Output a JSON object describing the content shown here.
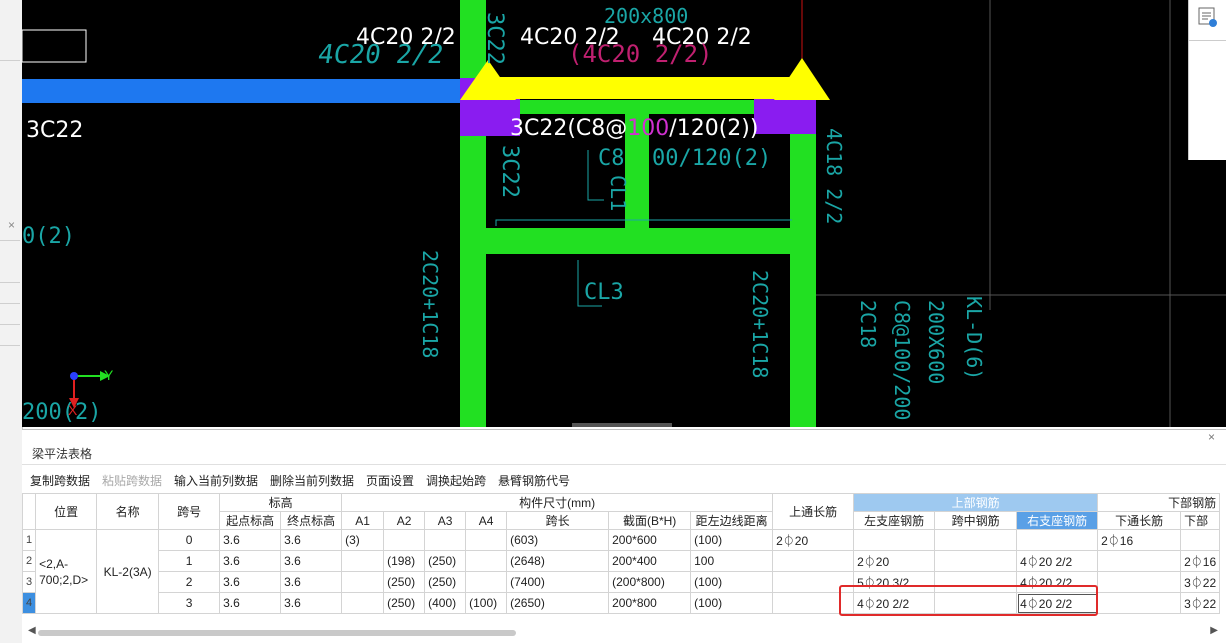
{
  "colors": {
    "cad_bg": "#000000",
    "beam_green": "#22e022",
    "beam_blue": "#1e78f0",
    "support_purple": "#8a1cf0",
    "arrow_yellow": "#ffff00",
    "cad_cyan": "#1aa6a6",
    "header_highlight": "#9ec9f0",
    "highlight_red": "#e02a2a"
  },
  "cad": {
    "labels_white": [
      "4C20 2/2",
      "4C20 2/2",
      "4C20 2/2",
      "3C22",
      "3C22(C8@",
      "100",
      "/120(2))"
    ],
    "labels_cyan": [
      "4C20 2/2",
      "3C22",
      "200x800",
      "3C22",
      "C8",
      "00/120(2)",
      "CL1",
      "CL3",
      "4C18 2/2",
      "2C20+1C18",
      "2C20+1C18",
      "KL-D(6)",
      "200X600",
      "C8@100/200",
      "2C18",
      "0(2)",
      "200(2)"
    ],
    "label_pink": "(4C20 2/2)",
    "axis_y": "Y",
    "axis_x": "X"
  },
  "panel": {
    "title": "梁平法表格",
    "close": "×",
    "toolbar": [
      {
        "label": "复制跨数据",
        "enabled": true
      },
      {
        "label": "粘贴跨数据",
        "enabled": false
      },
      {
        "label": "输入当前列数据",
        "enabled": true
      },
      {
        "label": "删除当前列数据",
        "enabled": true
      },
      {
        "label": "页面设置",
        "enabled": true
      },
      {
        "label": "调换起始跨",
        "enabled": true
      },
      {
        "label": "悬臂钢筋代号",
        "enabled": true
      }
    ],
    "headers": {
      "position": "位置",
      "name": "名称",
      "span_no": "跨号",
      "elevation": "标高",
      "start_elev": "起点标高",
      "end_elev": "终点标高",
      "dims": "构件尺寸(mm)",
      "a1": "A1",
      "a2": "A2",
      "a3": "A3",
      "a4": "A4",
      "span_len": "跨长",
      "section": "截面(B*H)",
      "edge_dist": "距左边线距离",
      "top_through": "上通长筋",
      "top_rebar": "上部钢筋",
      "left_support": "左支座钢筋",
      "mid_span": "跨中钢筋",
      "right_support": "右支座钢筋",
      "bottom_rebar": "下部钢筋",
      "bottom_through": "下通长筋",
      "bottom_cut": "下部"
    },
    "row_numbers": [
      "1",
      "2",
      "3",
      "4"
    ],
    "position_value": "<2,A-700;2,D>",
    "name_value": "KL-2(3A)",
    "rows": [
      {
        "span": "0",
        "start": "3.6",
        "end": "3.6",
        "a1": "(3)",
        "a2": "",
        "a3": "",
        "a4": "",
        "len": "(603)",
        "section": "200*600",
        "dist": "(100)",
        "top_through": "2⏀20",
        "left": "",
        "mid": "",
        "right": "",
        "bot_through": "2⏀16",
        "bot": ""
      },
      {
        "span": "1",
        "start": "3.6",
        "end": "3.6",
        "a1": "",
        "a2": "(198)",
        "a3": "(250)",
        "a4": "",
        "len": "(2648)",
        "section": "200*400",
        "dist": "100",
        "top_through": "",
        "left": "2⏀20",
        "mid": "",
        "right": "4⏀20 2/2",
        "bot_through": "",
        "bot": "2⏀16"
      },
      {
        "span": "2",
        "start": "3.6",
        "end": "3.6",
        "a1": "",
        "a2": "(250)",
        "a3": "(250)",
        "a4": "",
        "len": "(7400)",
        "section": "(200*800)",
        "dist": "(100)",
        "top_through": "",
        "left": "5⏀20 3/2",
        "mid": "",
        "right": "4⏀20 2/2",
        "bot_through": "",
        "bot": "3⏀22"
      },
      {
        "span": "3",
        "start": "3.6",
        "end": "3.6",
        "a1": "",
        "a2": "(250)",
        "a3": "(400)",
        "a4": "(100)",
        "len": "(2650)",
        "section": "200*800",
        "dist": "(100)",
        "top_through": "",
        "left": "4⏀20 2/2",
        "mid": "",
        "right": "4⏀20 2/2",
        "bot_through": "",
        "bot": "3⏀22"
      }
    ]
  }
}
